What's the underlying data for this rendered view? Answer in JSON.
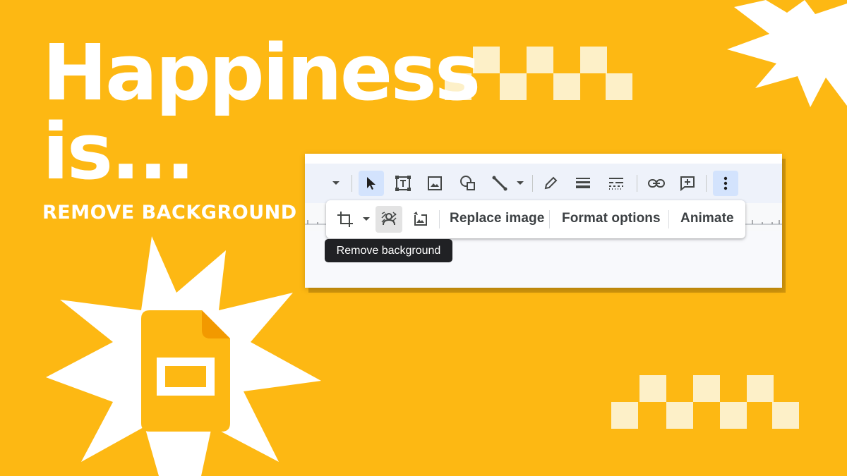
{
  "headline": {
    "line1": "Happiness",
    "line2": "is...",
    "subhead": "REMOVE BACKGROUND"
  },
  "colors": {
    "background": "#FDB813",
    "accent_blue": "#D3E3FD",
    "checker": "#FDF0C8",
    "tooltip_bg": "#202124"
  },
  "toolbar": {
    "icons": [
      "chevron-down-icon",
      "select-cursor-icon",
      "text-box-icon",
      "image-icon",
      "shape-icon",
      "line-icon",
      "chevron-down-icon",
      "pen-icon",
      "border-weight-icon",
      "border-dash-icon",
      "link-icon",
      "add-comment-icon",
      "more-vert-icon"
    ]
  },
  "image_toolbar": {
    "icons": [
      "crop-icon",
      "chevron-down-icon",
      "remove-background-icon",
      "reset-image-icon"
    ],
    "replace_image": "Replace image",
    "format_options": "Format options",
    "animate": "Animate"
  },
  "tooltip": {
    "text": "Remove background"
  },
  "logo": "google-slides-icon"
}
